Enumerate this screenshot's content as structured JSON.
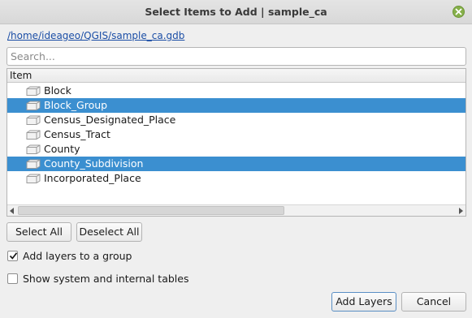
{
  "window": {
    "title": "Select Items to Add | sample_ca",
    "close_icon": "close-icon"
  },
  "path_link": "/home/ideageo/QGIS/sample_ca.gdb",
  "search": {
    "placeholder": "Search...",
    "value": ""
  },
  "tree": {
    "header": "Item",
    "item_icon": "table-icon",
    "items": [
      {
        "label": "Block",
        "selected": false
      },
      {
        "label": "Block_Group",
        "selected": true
      },
      {
        "label": "Census_Designated_Place",
        "selected": false
      },
      {
        "label": "Census_Tract",
        "selected": false
      },
      {
        "label": "County",
        "selected": false
      },
      {
        "label": "County_Subdivision",
        "selected": true
      },
      {
        "label": "Incorporated_Place",
        "selected": false
      }
    ]
  },
  "buttons": {
    "select_all": "Select All",
    "deselect_all": "Deselect All",
    "add_layers": "Add Layers",
    "cancel": "Cancel"
  },
  "options": {
    "add_to_group": {
      "label": "Add layers to a group",
      "checked": true
    },
    "show_system": {
      "label": "Show system and internal tables",
      "checked": false
    }
  },
  "colors": {
    "selection": "#3b8fd0",
    "link": "#1b4ea6",
    "close_button": "#86b04a"
  }
}
